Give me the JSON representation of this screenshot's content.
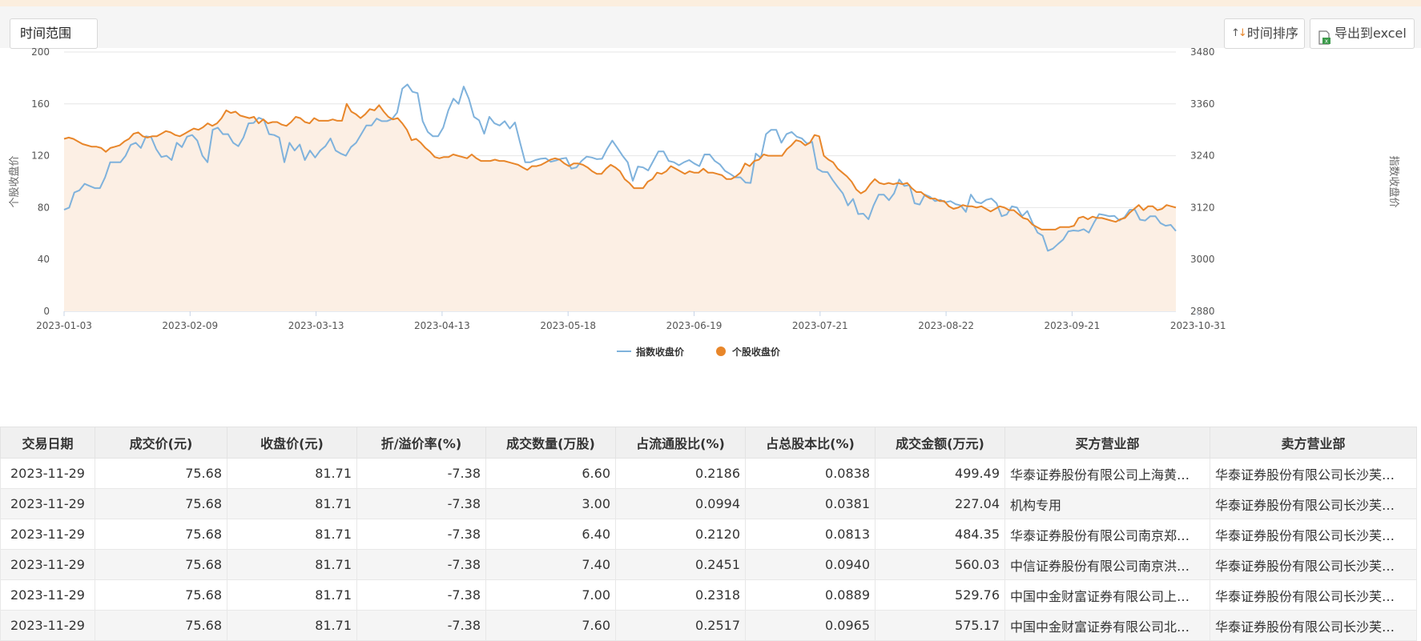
{
  "toolbar": {
    "range_label": "时间范围",
    "sort_label": "时间排序",
    "export_label": "导出到excel"
  },
  "colors": {
    "index_line": "#7fb2dc",
    "stock_line": "#e8862a",
    "stock_fill": "#fcefe4",
    "grid": "#e6e6e6"
  },
  "chart_data": {
    "type": "line",
    "x_labels": [
      "2023-01-03",
      "2023-02-09",
      "2023-03-13",
      "2023-04-13",
      "2023-05-18",
      "2023-06-19",
      "2023-07-21",
      "2023-08-22",
      "2023-09-21",
      "2023-10-31"
    ],
    "y_left": {
      "label": "个股收盘价",
      "ticks": [
        0,
        40,
        80,
        120,
        160,
        200
      ],
      "range": [
        0,
        200
      ]
    },
    "y_right": {
      "label": "指数收盘价",
      "ticks": [
        2880,
        3000,
        3120,
        3240,
        3360,
        3480
      ],
      "range": [
        2880,
        3480
      ]
    },
    "series": [
      {
        "name": "指数收盘价",
        "axis": "right",
        "values": [
          3115,
          3120,
          3155,
          3160,
          3175,
          3170,
          3165,
          3165,
          3190,
          3225,
          3225,
          3225,
          3240,
          3265,
          3270,
          3258,
          3285,
          3283,
          3255,
          3237,
          3240,
          3230,
          3270,
          3260,
          3284,
          3288,
          3275,
          3240,
          3225,
          3300,
          3305,
          3290,
          3290,
          3270,
          3262,
          3282,
          3315,
          3316,
          3328,
          3323,
          3290,
          3288,
          3282,
          3225,
          3270,
          3252,
          3266,
          3230,
          3252,
          3236,
          3252,
          3262,
          3280,
          3252,
          3245,
          3240,
          3260,
          3270,
          3290,
          3310,
          3310,
          3326,
          3320,
          3320,
          3325,
          3340,
          3395,
          3405,
          3388,
          3385,
          3320,
          3295,
          3285,
          3285,
          3305,
          3345,
          3372,
          3360,
          3400,
          3372,
          3330,
          3322,
          3291,
          3330,
          3315,
          3310,
          3320,
          3303,
          3317,
          3270,
          3225,
          3225,
          3230,
          3233,
          3234,
          3226,
          3229,
          3233,
          3235,
          3210,
          3213,
          3228,
          3238,
          3236,
          3232,
          3233,
          3256,
          3275,
          3258,
          3240,
          3225,
          3182,
          3215,
          3213,
          3206,
          3228,
          3250,
          3250,
          3228,
          3225,
          3218,
          3225,
          3230,
          3222,
          3216,
          3243,
          3243,
          3228,
          3220,
          3205,
          3198,
          3190,
          3190,
          3178,
          3177,
          3245,
          3235,
          3290,
          3300,
          3300,
          3270,
          3290,
          3295,
          3284,
          3280,
          3268,
          3272,
          3210,
          3203,
          3202,
          3184,
          3168,
          3153,
          3125,
          3140,
          3105,
          3106,
          3093,
          3125,
          3150,
          3150,
          3137,
          3153,
          3185,
          3170,
          3172,
          3130,
          3127,
          3150,
          3145,
          3135,
          3138,
          3132,
          3135,
          3128,
          3125,
          3110,
          3150,
          3133,
          3130,
          3138,
          3141,
          3130,
          3100,
          3104,
          3123,
          3120,
          3100,
          3112,
          3085,
          3062,
          3055,
          3020,
          3025,
          3036,
          3046,
          3065,
          3067,
          3066,
          3070,
          3062,
          3085,
          3105,
          3103,
          3100,
          3101,
          3090,
          3098,
          3115,
          3115,
          3092,
          3090,
          3100,
          3100,
          3084,
          3078,
          3080,
          3066
        ],
        "color": "#7fb2dc"
      },
      {
        "name": "个股收盘价",
        "axis": "left",
        "values": [
          133,
          134,
          133,
          131,
          129,
          128,
          127,
          127,
          126,
          123,
          126,
          127,
          128,
          131,
          133,
          137,
          138,
          135,
          134,
          135,
          135,
          137,
          139,
          138,
          136,
          135,
          137,
          139,
          141,
          140,
          142,
          145,
          143,
          145,
          149,
          155,
          153,
          154,
          151,
          150,
          149,
          150,
          145,
          148,
          145,
          146,
          146,
          144,
          143,
          146,
          150,
          149,
          146,
          145,
          149,
          147,
          147,
          147,
          148,
          147,
          147,
          160,
          154,
          152,
          149,
          152,
          156,
          155,
          159,
          154,
          150,
          148,
          149,
          145,
          140,
          132,
          133,
          130,
          126,
          123,
          119,
          118,
          119,
          119,
          121,
          120,
          119,
          118,
          121,
          118,
          116,
          116,
          116,
          117,
          116,
          116,
          115,
          114,
          113,
          111,
          109,
          112,
          112,
          113,
          115,
          117,
          118,
          117,
          114,
          112,
          114,
          114,
          113,
          111,
          108,
          106,
          106,
          110,
          113,
          111,
          108,
          102,
          99,
          95,
          95,
          95,
          100,
          102,
          107,
          106,
          108,
          112,
          110,
          108,
          106,
          108,
          107,
          107,
          110,
          107,
          107,
          106,
          105,
          102,
          102,
          104,
          107,
          114,
          112,
          116,
          117,
          121,
          120,
          120,
          120,
          120,
          125,
          128,
          132,
          131,
          128,
          130,
          136,
          135,
          120,
          117,
          115,
          110,
          107,
          104,
          100,
          94,
          91,
          93,
          98,
          102,
          99,
          98,
          99,
          98,
          99,
          98,
          99,
          95,
          92,
          92,
          89,
          87,
          87,
          85,
          85,
          81,
          79,
          80,
          82,
          81,
          81,
          80,
          81,
          79,
          77,
          79,
          81,
          80,
          78,
          78,
          75,
          72,
          71,
          67,
          65,
          63,
          63,
          63,
          63,
          65,
          65,
          65,
          66,
          72,
          73,
          71,
          73,
          72,
          72,
          71,
          70,
          69,
          71,
          72,
          76,
          79,
          82,
          78,
          81,
          81,
          78,
          79,
          82,
          81,
          80
        ],
        "color": "#e8862a"
      }
    ],
    "legend": [
      "指数收盘价",
      "个股收盘价"
    ],
    "legend_position": "bottom-center",
    "grid": true
  },
  "table": {
    "headers": [
      "交易日期",
      "成交价(元)",
      "收盘价(元)",
      "折/溢价率(%)",
      "成交数量(万股)",
      "占流通股比(%)",
      "占总股本比(%)",
      "成交金额(万元)",
      "买方营业部",
      "卖方营业部"
    ],
    "rows": [
      [
        "2023-11-29",
        "75.68",
        "81.71",
        "-7.38",
        "6.60",
        "0.2186",
        "0.0838",
        "499.49",
        "华泰证券股份有限公司上海黄…",
        "华泰证券股份有限公司长沙芙…"
      ],
      [
        "2023-11-29",
        "75.68",
        "81.71",
        "-7.38",
        "3.00",
        "0.0994",
        "0.0381",
        "227.04",
        "机构专用",
        "华泰证券股份有限公司长沙芙…"
      ],
      [
        "2023-11-29",
        "75.68",
        "81.71",
        "-7.38",
        "6.40",
        "0.2120",
        "0.0813",
        "484.35",
        "华泰证券股份有限公司南京郑…",
        "华泰证券股份有限公司长沙芙…"
      ],
      [
        "2023-11-29",
        "75.68",
        "81.71",
        "-7.38",
        "7.40",
        "0.2451",
        "0.0940",
        "560.03",
        "中信证券股份有限公司南京洪…",
        "华泰证券股份有限公司长沙芙…"
      ],
      [
        "2023-11-29",
        "75.68",
        "81.71",
        "-7.38",
        "7.00",
        "0.2318",
        "0.0889",
        "529.76",
        "中国中金财富证券有限公司上…",
        "华泰证券股份有限公司长沙芙…"
      ],
      [
        "2023-11-29",
        "75.68",
        "81.71",
        "-7.38",
        "7.60",
        "0.2517",
        "0.0965",
        "575.17",
        "中国中金财富证券有限公司北…",
        "华泰证券股份有限公司长沙芙…"
      ]
    ]
  }
}
